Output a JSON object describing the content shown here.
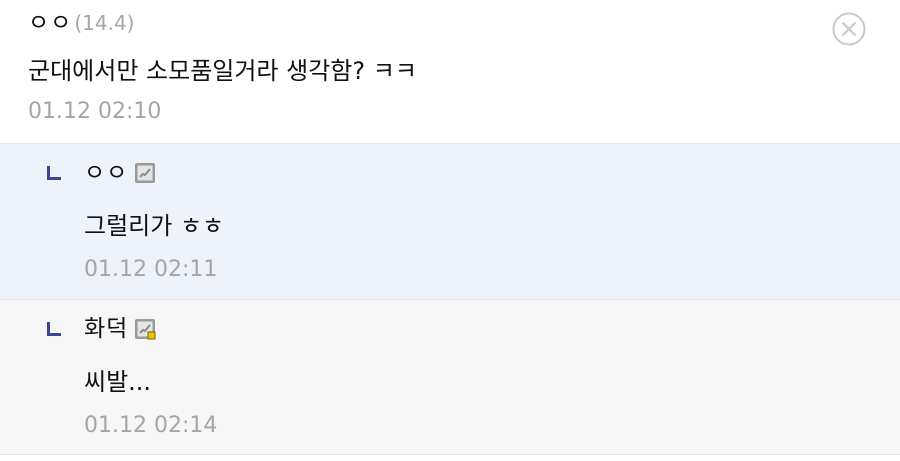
{
  "comment": {
    "author": "ㅇㅇ",
    "ip": "(14.4)",
    "text": "군대에서만 소모품일거라 생각함? ㅋㅋ",
    "date": "01.12 02:10",
    "delete_icon": "close-circle-icon"
  },
  "replies": [
    {
      "author": "ㅇㅇ",
      "user_icon": "fixed-nick-icon",
      "text": "그럴리가 ㅎㅎ",
      "date": "01.12 02:11"
    },
    {
      "author": "화덕",
      "user_icon": "semi-fixed-nick-icon",
      "text": "씨발...",
      "date": "01.12 02:14"
    }
  ],
  "colors": {
    "reply_highlight_bg": "#eef2fa",
    "reply_bg": "#f6f6f6",
    "reply_arrow": "#3b4890",
    "meta_text": "#a5a5a5"
  }
}
